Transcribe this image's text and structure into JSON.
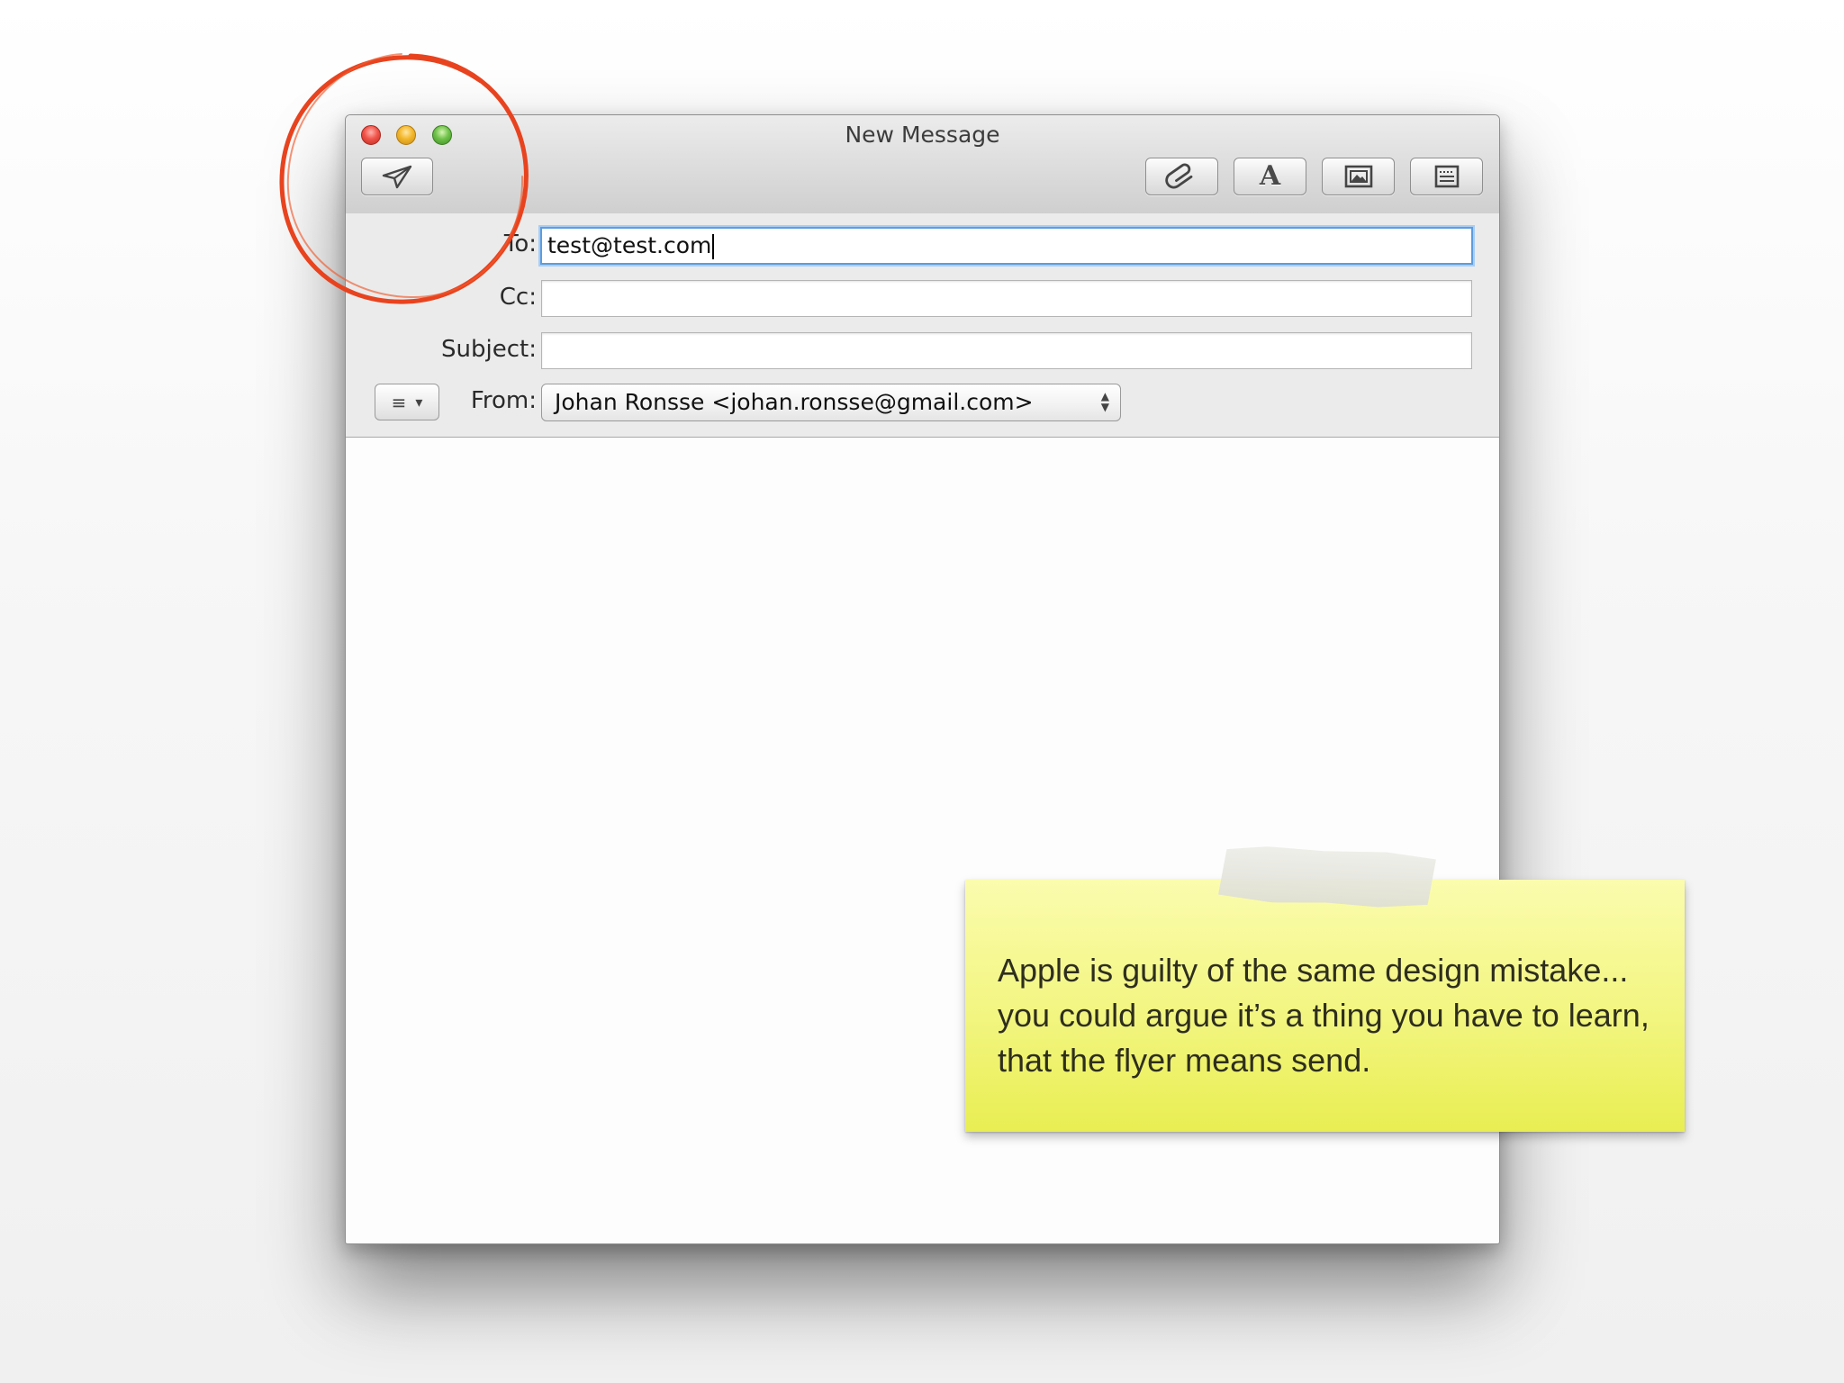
{
  "window": {
    "title": "New Message",
    "controls": [
      "close-icon",
      "minimize-icon",
      "zoom-icon"
    ]
  },
  "toolbar": {
    "send_icon": "paper-plane-icon",
    "attach_icon": "paperclip-icon",
    "fonts_glyph": "A",
    "photo_icon": "photo-browser-icon",
    "stationery_icon": "stationery-icon"
  },
  "fields": {
    "to_label": "To:",
    "to_value": "test@test.com",
    "cc_label": "Cc:",
    "cc_value": "",
    "subject_label": "Subject:",
    "subject_value": "",
    "from_label": "From:",
    "from_value": "Johan Ronsse <johan.ronsse@gmail.com>"
  },
  "format_menu": {
    "icon": "list-icon",
    "glyph": "≡",
    "arrow": "▾"
  },
  "annotation": {
    "circle_color": "#e8431f",
    "note_text": "Apple is guilty of the same design mistake... you could argue it’s a thing you have to learn, that the flyer means send."
  },
  "colors": {
    "focus_ring": "#5d9ce0",
    "note_yellow": "#f2f57f"
  }
}
